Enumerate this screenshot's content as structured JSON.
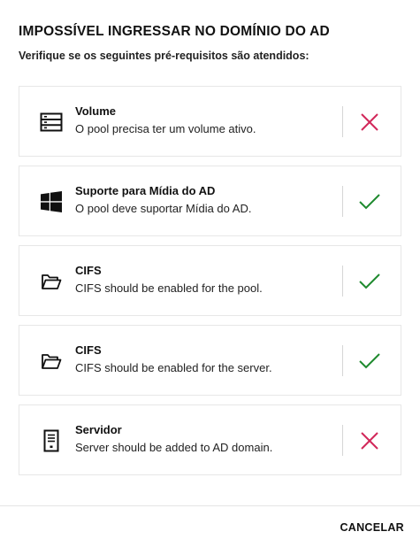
{
  "dialog": {
    "title": "IMPOSSÍVEL INGRESSAR NO DOMÍNIO DO AD",
    "subtitle": "Verifique se os seguintes pré-requisitos são atendidos:",
    "cancel_label": "CANCELAR"
  },
  "requirements": [
    {
      "icon": "storage-volume-icon",
      "name": "Volume",
      "description": "O pool precisa ter um volume ativo.",
      "status": "failed"
    },
    {
      "icon": "windows-logo-icon",
      "name": "Suporte para Mídia do AD",
      "description": "O pool deve suportar Mídia do AD.",
      "status": "passed"
    },
    {
      "icon": "folder-open-icon",
      "name": "CIFS",
      "description": "CIFS should be enabled for the pool.",
      "status": "passed"
    },
    {
      "icon": "folder-open-icon",
      "name": "CIFS",
      "description": "CIFS should be enabled for the server.",
      "status": "passed"
    },
    {
      "icon": "server-icon",
      "name": "Servidor",
      "description": "Server should be added to AD domain.",
      "status": "failed"
    }
  ],
  "colors": {
    "passed": "#1e8a2e",
    "failed": "#d2285a",
    "border": "#e7e7e7"
  }
}
